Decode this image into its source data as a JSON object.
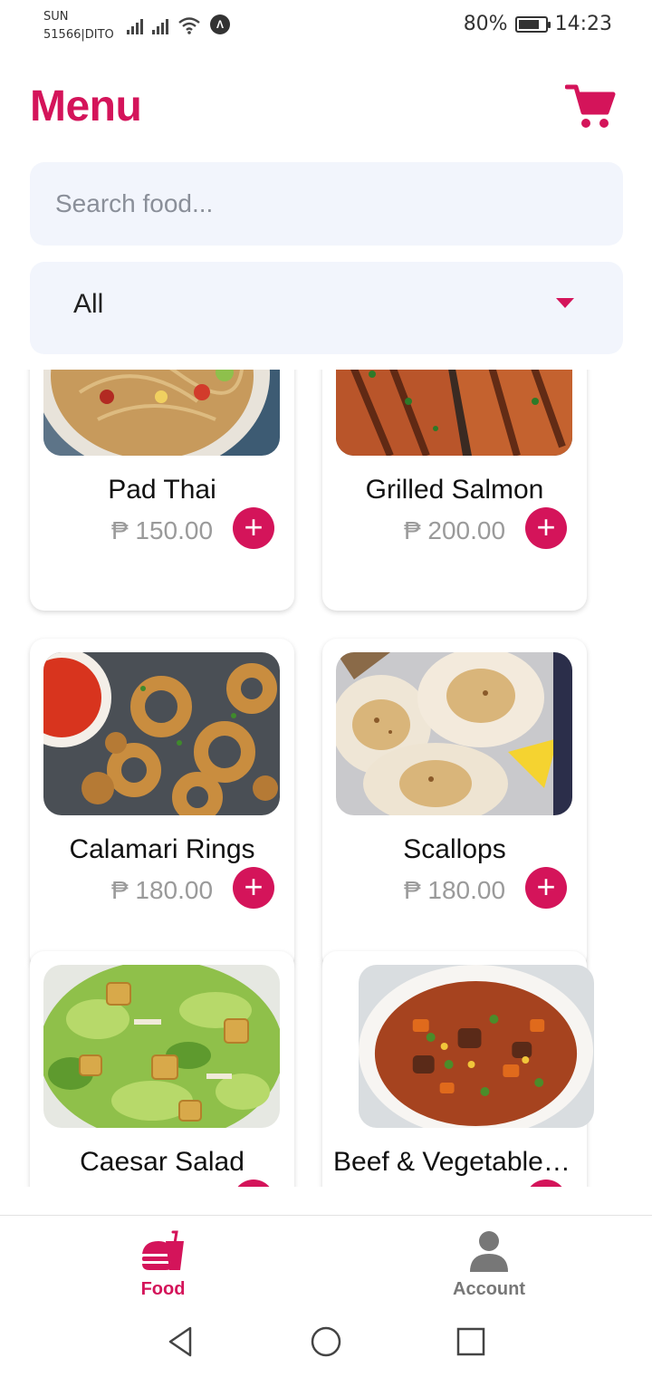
{
  "status_bar": {
    "carrier_line1": "SUN",
    "carrier_line2": "51566|DITO",
    "battery": "80%",
    "battery_level": 0.8,
    "time": "14:23"
  },
  "header": {
    "title": "Menu",
    "cart_icon": "cart-icon"
  },
  "search": {
    "placeholder": "Search food...",
    "value": ""
  },
  "category_filter": {
    "selected": "All"
  },
  "menu_items": [
    {
      "name": "Pad Thai",
      "price": "₱ 150.00",
      "image": "pad-thai-image"
    },
    {
      "name": "Grilled Salmon",
      "price": "₱ 200.00",
      "image": "grilled-salmon-image"
    },
    {
      "name": "Calamari Rings",
      "price": "₱ 180.00",
      "image": "calamari-image"
    },
    {
      "name": "Scallops",
      "price": "₱ 180.00",
      "image": "scallops-image"
    },
    {
      "name": "Caesar Salad",
      "price": "",
      "image": "caesar-salad-image"
    },
    {
      "name": "Beef & Vegetable S...",
      "price": "",
      "image": "beef-vegetable-soup-image"
    }
  ],
  "add_label": "+",
  "bottom_nav": {
    "food_label": "Food",
    "account_label": "Account",
    "active": "Food"
  },
  "colors": {
    "accent": "#d4145a",
    "input_bg": "#f2f5fc",
    "muted": "#9a9a9a"
  }
}
